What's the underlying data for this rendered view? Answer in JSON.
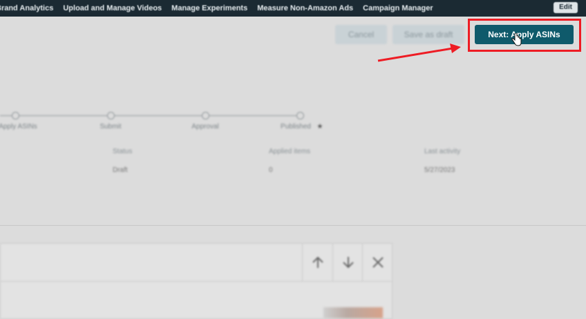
{
  "nav": {
    "items": [
      "Brand Analytics",
      "Upload and Manage Videos",
      "Manage Experiments",
      "Measure Non-Amazon Ads",
      "Campaign Manager"
    ],
    "edit_label": "Edit"
  },
  "toolbar": {
    "cancel_label": "Cancel",
    "save_draft_label": "Save as draft",
    "next_label": "Next: Apply ASINs"
  },
  "stepper": {
    "steps": [
      "Apply ASINs",
      "Submit",
      "Approval",
      "Published"
    ],
    "published_marker": "★"
  },
  "info": {
    "status_label": "Status",
    "status_value": "Draft",
    "applied_label": "Applied items",
    "applied_value": "0",
    "activity_label": "Last activity",
    "activity_value": "5/27/2023"
  },
  "panel": {
    "icons": [
      "arrow-up-icon",
      "arrow-down-icon",
      "close-icon"
    ]
  },
  "colors": {
    "primary_button": "#0f5a6b",
    "highlight": "#ee1c24",
    "top_bar": "#1b2a33"
  }
}
